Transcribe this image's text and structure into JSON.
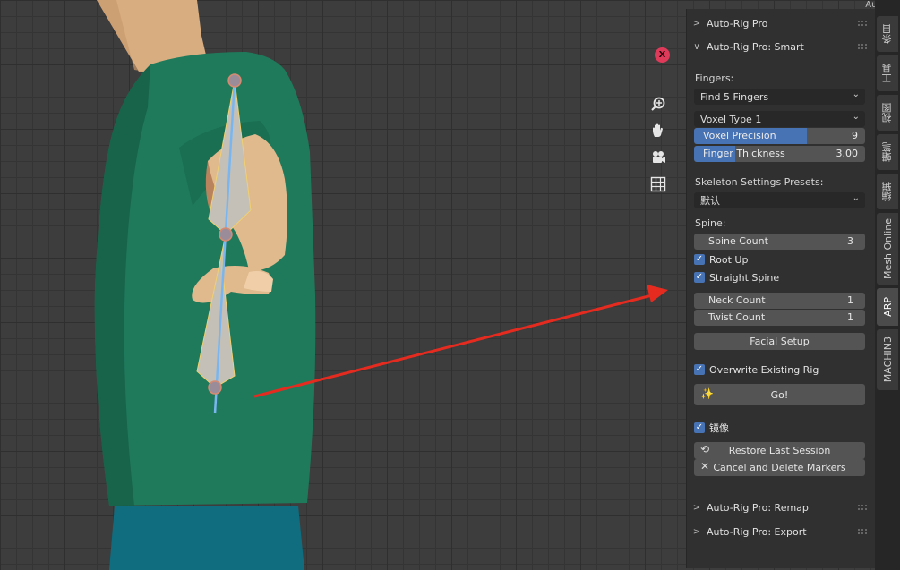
{
  "top_clip": "Auto-Ri",
  "viewport_tools": {
    "close": "X",
    "zoom_icon": "zoom-in-icon",
    "hand_icon": "pan-hand-icon",
    "camera_icon": "camera-icon",
    "grid_icon": "grid-icon"
  },
  "panel": {
    "section_autorig": "Auto-Rig Pro",
    "section_smart": "Auto-Rig Pro: Smart",
    "fingers_label": "Fingers:",
    "fingers_dropdown": "Find 5 Fingers",
    "voxel_type": "Voxel Type 1",
    "voxel_precision": {
      "label": "Voxel Precision",
      "value": "9",
      "fill": 0.66
    },
    "finger_thickness": {
      "label": "Finger Thickness",
      "value": "3.00",
      "fill": 0.24
    },
    "presets_label": "Skeleton Settings Presets:",
    "presets_value": "默认",
    "spine_label": "Spine:",
    "spine_count": {
      "label": "Spine Count",
      "value": "3"
    },
    "root_up": "Root Up",
    "straight_spine": "Straight Spine",
    "neck_count": {
      "label": "Neck Count",
      "value": "1"
    },
    "twist_count": {
      "label": "Twist Count",
      "value": "1"
    },
    "facial_setup": "Facial Setup",
    "overwrite": "Overwrite Existing Rig",
    "go": "Go!",
    "mirror": "镜像",
    "restore": "Restore Last Session",
    "cancel": "Cancel and Delete Markers",
    "section_remap": "Auto-Rig Pro: Remap",
    "section_export": "Auto-Rig Pro: Export"
  },
  "tabs": [
    "条目",
    "工具",
    "视图",
    "蜡笔",
    "编辑",
    "Mesh Online",
    "ARP",
    "MACHIN3"
  ],
  "colors": {
    "accent": "#4772b3",
    "shirt": "#1f7a5c",
    "pants": "#0f6d7f",
    "skin": "#e0b98d",
    "arrow": "#e52b20"
  }
}
